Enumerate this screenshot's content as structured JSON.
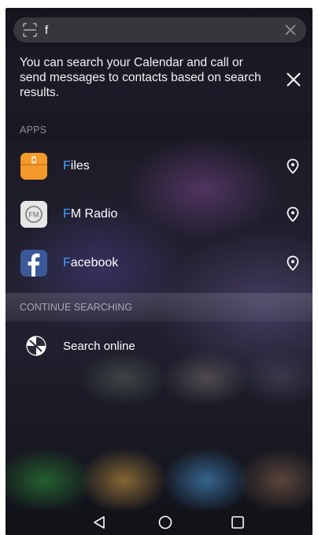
{
  "search": {
    "query": "f",
    "scan_icon": "scan-icon",
    "clear_icon": "close-icon"
  },
  "tip": {
    "text": "You can search your Calendar and call or send messages to contacts based on search results.",
    "close_icon": "close-icon"
  },
  "apps_section": {
    "header": "APPS",
    "items": [
      {
        "prefix": "F",
        "rest": "iles",
        "icon": "files-app-icon",
        "action_icon": "location-pin-icon",
        "icon_color": "#f39a2b"
      },
      {
        "prefix": "F",
        "rest": "M Radio",
        "icon": "fm-radio-app-icon",
        "action_icon": "location-pin-icon",
        "icon_color": "#e9e9e9"
      },
      {
        "prefix": "F",
        "rest": "acebook",
        "icon": "facebook-app-icon",
        "action_icon": "location-pin-icon",
        "icon_color": "#3b5998"
      }
    ]
  },
  "continue_section": {
    "header": "CONTINUE SEARCHING",
    "online_label": "Search online",
    "online_icon": "browser-globe-icon"
  },
  "nav_bar": {
    "back_icon": "back-triangle-icon",
    "home_icon": "home-circle-icon",
    "recent_icon": "recent-square-icon"
  },
  "colors": {
    "highlight": "#4a9bff"
  }
}
